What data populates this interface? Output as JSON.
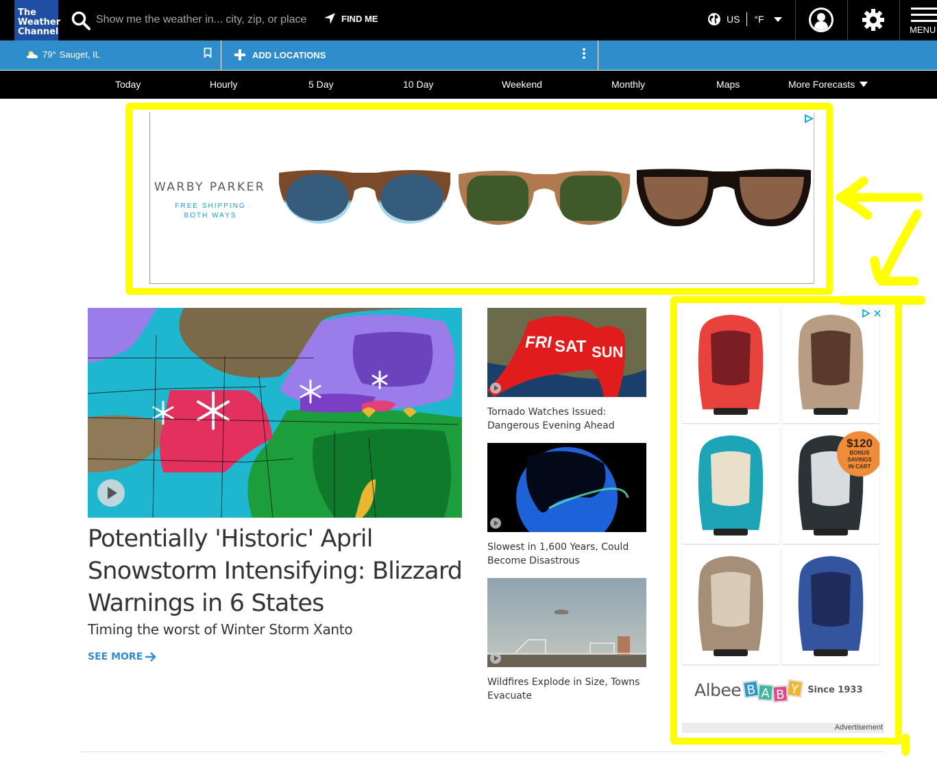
{
  "header": {
    "logo_lines": [
      "The",
      "Weather",
      "Channel"
    ],
    "search_placeholder": "Show me the weather in... city, zip, or place",
    "find_me_label": "FIND ME",
    "region": "US",
    "unit": "°F",
    "menu_label": "MENU",
    "icons": {
      "search": "search-icon",
      "find_me": "location-arrow-icon",
      "region": "globe-icon",
      "account": "user-circle-icon",
      "settings": "gear-icon",
      "menu": "hamburger-icon"
    }
  },
  "location_bar": {
    "current_temp": "79°",
    "current_location": "Sauget, IL",
    "weather_icon": "partly-cloudy-icon",
    "add_locations_label": "ADD LOCATIONS"
  },
  "forecast_nav": {
    "items": [
      "Today",
      "Hourly",
      "5 Day",
      "10 Day",
      "Weekend",
      "Monthly",
      "Maps",
      "More Forecasts"
    ]
  },
  "ad_top": {
    "brand": "WARBY PARKER",
    "tagline_lines": [
      "FREE SHIPPING",
      "BOTH WAYS"
    ],
    "products": [
      {
        "name": "sunglasses-blue-lens",
        "frame": "#7a4a2a",
        "frame_bottom": "#a9d6e8",
        "lens": "#355c7a"
      },
      {
        "name": "sunglasses-green-lens",
        "frame": "#b07a4e",
        "frame_bottom": "#c99063",
        "lens": "#3e5a2a"
      },
      {
        "name": "sunglasses-brown-lens",
        "frame": "#1a0f0a",
        "frame_bottom": "#2a140a",
        "lens": "#8a6046"
      }
    ]
  },
  "main_story": {
    "headline": "Potentially 'Historic' April Snowstorm Intensifying: Blizzard Warnings in 6 States",
    "subhead": "Timing the worst of Winter Storm Xanto",
    "see_more_label": "SEE MORE"
  },
  "side_stories": [
    {
      "title": "Tornado Watches Issued: Dangerous Evening Ahead",
      "thumb_labels": [
        "FRI",
        "SAT",
        "SUN"
      ]
    },
    {
      "title": "Slowest in 1,600 Years, Could Become Disastrous"
    },
    {
      "title": "Wildfires Explode in Size, Towns Evacuate"
    }
  ],
  "ad_side": {
    "tiles": [
      {
        "name": "car-seat-red",
        "color": "#e8423c",
        "dark": "#7a1e24"
      },
      {
        "name": "car-seat-tan",
        "color": "#b89c84",
        "dark": "#5a3a2a"
      },
      {
        "name": "car-seat-teal",
        "color": "#1ea5b5",
        "dark": "#e9dfcb"
      },
      {
        "name": "car-seat-black",
        "color": "#2a3436",
        "dark": "#d8dcde"
      },
      {
        "name": "car-seat-beige",
        "color": "#a58f78",
        "dark": "#d9cbb8"
      },
      {
        "name": "car-seat-blue",
        "color": "#3355a0",
        "dark": "#1d2c5a"
      }
    ],
    "bonus_amount": "$120",
    "bonus_lines": [
      "BONUS",
      "SAVINGS",
      "IN CART"
    ],
    "brand_word": "Albee",
    "brand_blocks": [
      "B",
      "A",
      "B",
      "Y"
    ],
    "brand_block_colors": [
      "#2e97c9",
      "#3bb7a2",
      "#e0468a",
      "#f0b72c"
    ],
    "since": "Since 1933",
    "ad_label": "Advertisement"
  },
  "annotation": {
    "highlight_color": "#ffff00"
  }
}
